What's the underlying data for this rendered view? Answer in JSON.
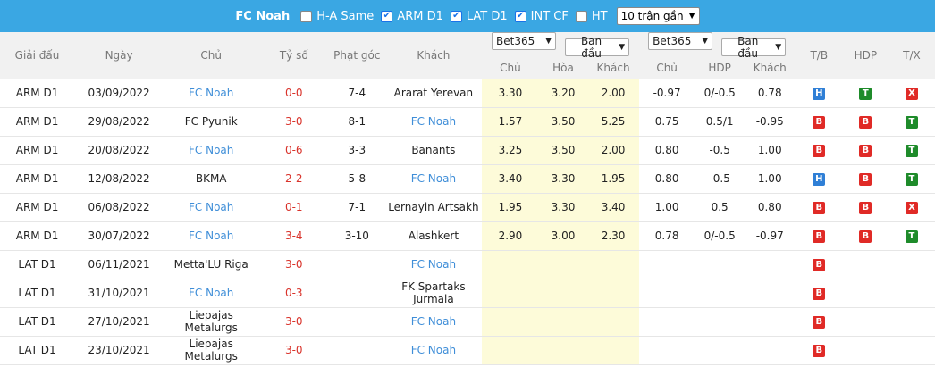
{
  "topbar": {
    "team": "FC Noah",
    "filters": [
      {
        "label": "H-A Same",
        "checked": false
      },
      {
        "label": "ARM D1",
        "checked": true
      },
      {
        "label": "LAT D1",
        "checked": true
      },
      {
        "label": "INT CF",
        "checked": true
      },
      {
        "label": "HT",
        "checked": false
      }
    ],
    "range_select": "10 trận gần"
  },
  "headers": {
    "league": "Giải đấu",
    "date": "Ngày",
    "home": "Chủ",
    "score": "Tỷ số",
    "corners": "Phạt góc",
    "away": "Khách",
    "book1": "Bet365",
    "type1": "Ban đầu",
    "book2": "Bet365",
    "type2": "Ban đầu",
    "eu_home": "Chủ",
    "eu_draw": "Hòa",
    "eu_away": "Khách",
    "ah_home": "Chủ",
    "ah_hdp": "HDP",
    "ah_away": "Khách",
    "tb": "T/B",
    "hdp": "HDP",
    "tx": "T/X"
  },
  "rows": [
    {
      "league": "ARM D1",
      "date": "03/09/2022",
      "home": "FC Noah",
      "home_is_team": true,
      "score": "0-0",
      "corners": "7-4",
      "away": "Ararat Yerevan",
      "away_is_team": false,
      "o1": "3.30",
      "o2": "3.20",
      "o3": "2.00",
      "a1": "-0.97",
      "a2": "0/-0.5",
      "a3": "0.78",
      "r1": "H",
      "r2": "T",
      "r3": "X"
    },
    {
      "league": "ARM D1",
      "date": "29/08/2022",
      "home": "FC Pyunik",
      "home_is_team": false,
      "score": "3-0",
      "corners": "8-1",
      "away": "FC Noah",
      "away_is_team": true,
      "o1": "1.57",
      "o2": "3.50",
      "o3": "5.25",
      "a1": "0.75",
      "a2": "0.5/1",
      "a3": "-0.95",
      "r1": "B",
      "r2": "B",
      "r3": "T"
    },
    {
      "league": "ARM D1",
      "date": "20/08/2022",
      "home": "FC Noah",
      "home_is_team": true,
      "score": "0-6",
      "corners": "3-3",
      "away": "Banants",
      "away_is_team": false,
      "o1": "3.25",
      "o2": "3.50",
      "o3": "2.00",
      "a1": "0.80",
      "a2": "-0.5",
      "a3": "1.00",
      "r1": "B",
      "r2": "B",
      "r3": "T"
    },
    {
      "league": "ARM D1",
      "date": "12/08/2022",
      "home": "BKMA",
      "home_is_team": false,
      "score": "2-2",
      "corners": "5-8",
      "away": "FC Noah",
      "away_is_team": true,
      "o1": "3.40",
      "o2": "3.30",
      "o3": "1.95",
      "a1": "0.80",
      "a2": "-0.5",
      "a3": "1.00",
      "r1": "H",
      "r2": "B",
      "r3": "T"
    },
    {
      "league": "ARM D1",
      "date": "06/08/2022",
      "home": "FC Noah",
      "home_is_team": true,
      "score": "0-1",
      "corners": "7-1",
      "away": "Lernayin Artsakh",
      "away_is_team": false,
      "o1": "1.95",
      "o2": "3.30",
      "o3": "3.40",
      "a1": "1.00",
      "a2": "0.5",
      "a3": "0.80",
      "r1": "B",
      "r2": "B",
      "r3": "X"
    },
    {
      "league": "ARM D1",
      "date": "30/07/2022",
      "home": "FC Noah",
      "home_is_team": true,
      "score": "3-4",
      "corners": "3-10",
      "away": "Alashkert",
      "away_is_team": false,
      "o1": "2.90",
      "o2": "3.00",
      "o3": "2.30",
      "a1": "0.78",
      "a2": "0/-0.5",
      "a3": "-0.97",
      "r1": "B",
      "r2": "B",
      "r3": "T"
    },
    {
      "league": "LAT D1",
      "date": "06/11/2021",
      "home": "Metta'LU Riga",
      "home_is_team": false,
      "score": "3-0",
      "corners": "",
      "away": "FC Noah",
      "away_is_team": true,
      "o1": "",
      "o2": "",
      "o3": "",
      "a1": "",
      "a2": "",
      "a3": "",
      "r1": "B",
      "r2": "",
      "r3": ""
    },
    {
      "league": "LAT D1",
      "date": "31/10/2021",
      "home": "FC Noah",
      "home_is_team": true,
      "score": "0-3",
      "corners": "",
      "away": "FK Spartaks Jurmala",
      "away_is_team": false,
      "o1": "",
      "o2": "",
      "o3": "",
      "a1": "",
      "a2": "",
      "a3": "",
      "r1": "B",
      "r2": "",
      "r3": ""
    },
    {
      "league": "LAT D1",
      "date": "27/10/2021",
      "home": "Liepajas Metalurgs",
      "home_is_team": false,
      "score": "3-0",
      "corners": "",
      "away": "FC Noah",
      "away_is_team": true,
      "o1": "",
      "o2": "",
      "o3": "",
      "a1": "",
      "a2": "",
      "a3": "",
      "r1": "B",
      "r2": "",
      "r3": ""
    },
    {
      "league": "LAT D1",
      "date": "23/10/2021",
      "home": "Liepajas Metalurgs",
      "home_is_team": false,
      "score": "3-0",
      "corners": "",
      "away": "FC Noah",
      "away_is_team": true,
      "o1": "",
      "o2": "",
      "o3": "",
      "a1": "",
      "a2": "",
      "a3": "",
      "r1": "B",
      "r2": "",
      "r3": ""
    }
  ]
}
